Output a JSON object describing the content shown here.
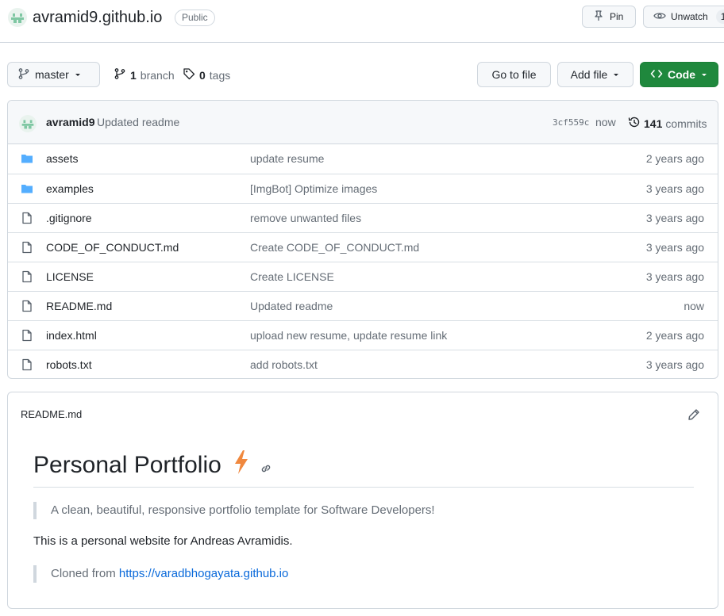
{
  "repo": {
    "name": "avramid9.github.io",
    "visibility": "Public",
    "pin_label": "Pin",
    "unwatch_label": "Unwatch",
    "watch_count": "1"
  },
  "toolbar": {
    "branch": "master",
    "branch_count": "1",
    "branch_word": "branch",
    "tag_count": "0",
    "tag_word": "tags",
    "goto_label": "Go to file",
    "addfile_label": "Add file",
    "code_label": "Code"
  },
  "latest_commit": {
    "author": "avramid9",
    "message": "Updated readme",
    "sha": "3cf559c",
    "time": "now",
    "count": "141",
    "count_word": "commits"
  },
  "files": [
    {
      "type": "folder",
      "name": "assets",
      "message": "update resume",
      "time": "2 years ago"
    },
    {
      "type": "folder",
      "name": "examples",
      "message": "[ImgBot] Optimize images",
      "time": "3 years ago"
    },
    {
      "type": "file",
      "name": ".gitignore",
      "message": "remove unwanted files",
      "time": "3 years ago"
    },
    {
      "type": "file",
      "name": "CODE_OF_CONDUCT.md",
      "message": "Create CODE_OF_CONDUCT.md",
      "time": "3 years ago"
    },
    {
      "type": "file",
      "name": "LICENSE",
      "message": "Create LICENSE",
      "time": "3 years ago"
    },
    {
      "type": "file",
      "name": "README.md",
      "message": "Updated readme",
      "time": "now"
    },
    {
      "type": "file",
      "name": "index.html",
      "message": "upload new resume, update resume link",
      "time": "2 years ago"
    },
    {
      "type": "file",
      "name": "robots.txt",
      "message": "add robots.txt",
      "time": "3 years ago"
    }
  ],
  "readme": {
    "filename": "README.md",
    "heading": "Personal Portfolio",
    "tagline": "A clean, beautiful, responsive portfolio template for Software Developers!",
    "description": "This is a personal website for Andreas Avramidis.",
    "cloned_prefix": "Cloned from",
    "cloned_link": "https://varadbhogayata.github.io"
  },
  "colors": {
    "code_button": "#1f883d",
    "folder_icon": "#54aeff",
    "link": "#0969da",
    "lightning": "#f0883e"
  }
}
